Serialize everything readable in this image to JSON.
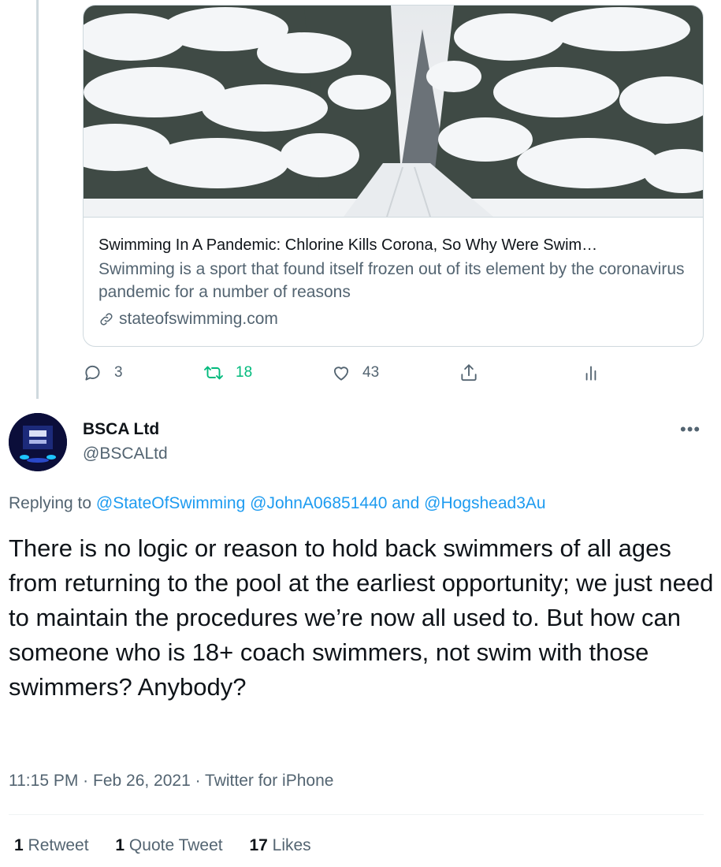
{
  "link_card": {
    "title": "Swimming In A Pandemic: Chlorine Kills Corona, So Why Were Swim…",
    "description": "Swimming is a sport that found itself frozen out of its element by the coronavirus pandemic for a number of reasons",
    "domain": "stateofswimming.com",
    "image_icon": "snowy-forest-image"
  },
  "actions": {
    "reply_count": "3",
    "retweet_count": "18",
    "like_count": "43",
    "icons": [
      "reply-icon",
      "retweet-icon",
      "like-icon",
      "share-icon",
      "analytics-icon"
    ]
  },
  "tweet": {
    "display_name": "BSCA Ltd",
    "handle": "@BSCALtd",
    "replying_prefix": "Replying to ",
    "mention_1": "@StateOfSwimming",
    "mention_2": "@JohnA06851440",
    "and_word": " and ",
    "mention_3": "@Hogshead3Au",
    "text": "There is no logic or reason to hold back swimmers of all ages from returning to the pool at the earliest opportunity; we just need to maintain the procedures we’re now all used to. But how can someone who is 18+ coach swimmers, not swim with those swimmers? Anybody?",
    "meta": "11:15 PM · Feb 26, 2021 · Twitter for iPhone",
    "more_label": "•••"
  },
  "stats": {
    "retweets_count": "1",
    "retweets_label": " Retweet",
    "quotes_count": "1",
    "quotes_label": " Quote Tweet",
    "likes_count": "17",
    "likes_label": " Likes"
  },
  "colors": {
    "accent": "#1d9bf0",
    "retweet_green": "#00ba7c",
    "secondary_text": "#536471"
  }
}
